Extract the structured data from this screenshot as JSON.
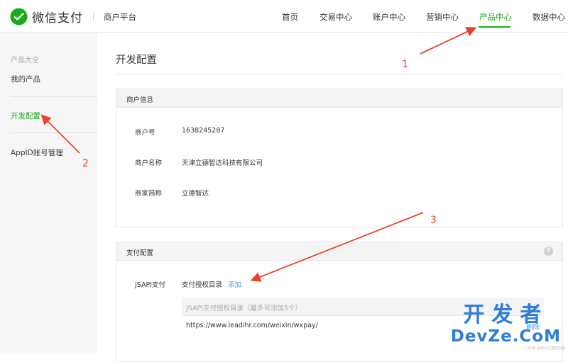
{
  "header": {
    "brand": "微信支付",
    "platform": "商户平台",
    "nav": [
      {
        "label": "首页"
      },
      {
        "label": "交易中心"
      },
      {
        "label": "账户中心"
      },
      {
        "label": "营销中心"
      },
      {
        "label": "产品中心",
        "active": true
      },
      {
        "label": "数据中心"
      }
    ]
  },
  "sidebar": {
    "group_label": "产品大全",
    "items": [
      {
        "label": "我的产品"
      },
      {
        "label": "开发配置",
        "active": true
      },
      {
        "label": "AppID账号管理"
      }
    ]
  },
  "main": {
    "title": "开发配置",
    "merchant_info": {
      "heading": "商户信息",
      "rows": [
        {
          "key": "商户号",
          "value": "1638245287"
        },
        {
          "key": "商户名称",
          "value": "天津立德智达科技有限公司"
        },
        {
          "key": "商家简称",
          "value": "立德智达"
        }
      ]
    },
    "pay_config": {
      "heading": "支付配置",
      "help_icon": "?",
      "jsapi_label": "JSAPI支付",
      "auth_dir_label": "支付授权目录",
      "add_link": "添加",
      "table": {
        "col_dir": "JSAPI支付授权目录（最多可添加5个）",
        "col_action": "操作",
        "rows": [
          {
            "dir": "https://www.leadihr.com/weixin/wxpay/",
            "action": "删除"
          }
        ]
      }
    }
  },
  "annotations": {
    "labels": [
      "1",
      "2",
      "3"
    ],
    "color": "#e8432e"
  },
  "watermark": {
    "cn": "开发者",
    "en": "DevZe.CoM",
    "small": "CSDN @初九之潜龙勿用"
  },
  "colors": {
    "accent": "#1aad19",
    "link": "#459ae9"
  }
}
